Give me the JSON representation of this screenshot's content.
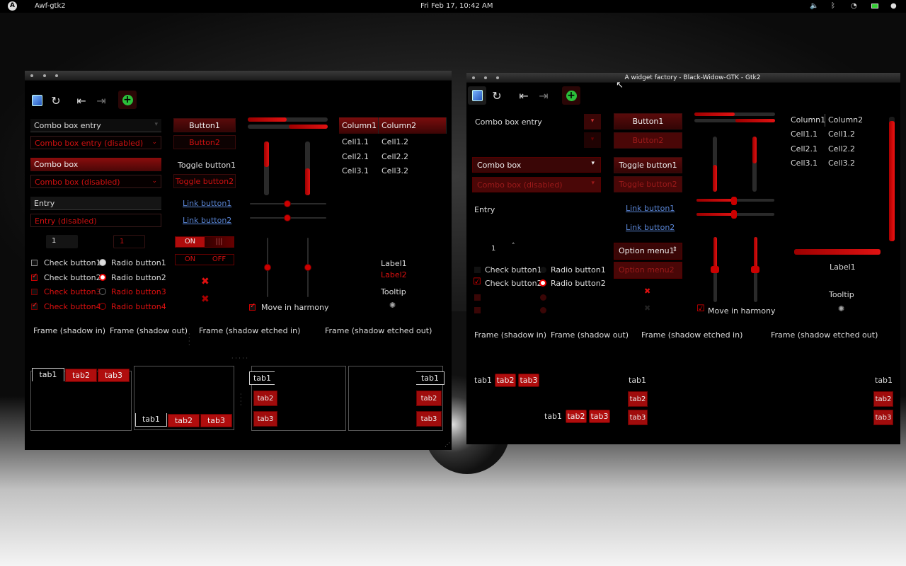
{
  "topbar": {
    "app": "Awf-gtk2",
    "clock": "Fri Feb 17, 10:42 AM"
  },
  "left": {
    "combo_entry": "Combo box entry",
    "combo_entry_dis": "Combo box entry (disabled)",
    "combo": "Combo box",
    "combo_dis": "Combo box (disabled)",
    "entry": "Entry",
    "entry_dis": "Entry (disabled)",
    "spin1": "1",
    "spin2": "1",
    "checks": [
      "Check button1",
      "Check button2",
      "Check button3",
      "Check button4"
    ],
    "radios": [
      "Radio button1",
      "Radio button2",
      "Radio button3",
      "Radio button4"
    ],
    "button1": "Button1",
    "button2": "Button2",
    "toggle1": "Toggle button1",
    "toggle2": "Toggle button2",
    "link1": "Link button1",
    "link2": "Link button2",
    "on": "ON",
    "off": "OFF",
    "bars": "|||",
    "columns": [
      "Column1",
      "Column2"
    ],
    "cells": [
      [
        "Cell1.1",
        "Cell1.2"
      ],
      [
        "Cell2.1",
        "Cell2.2"
      ],
      [
        "Cell3.1",
        "Cell3.2"
      ]
    ],
    "label1": "Label1",
    "label2": "Label2",
    "tooltip": "Tooltip",
    "move": "Move in harmony",
    "frames": [
      "Frame (shadow in)",
      "Frame (shadow out)",
      "Frame (shadow etched in)",
      "Frame (shadow etched out)"
    ],
    "tabs": [
      "tab1",
      "tab2",
      "tab3"
    ]
  },
  "right": {
    "title": "A widget factory - Black-Widow-GTK - Gtk2",
    "combo_entry": "Combo box entry",
    "combo": "Combo box",
    "combo_dis": "Combo box (disabled)",
    "entry": "Entry",
    "spin": "1",
    "button1": "Button1",
    "button2": "Button2",
    "toggle1": "Toggle button1",
    "toggle2": "Toggle button2",
    "link1": "Link button1",
    "link2": "Link button2",
    "opt1": "Option menu1",
    "opt2": "Option menu2",
    "checks": [
      "Check button1",
      "Check button2"
    ],
    "radios": [
      "Radio button1",
      "Radio button2"
    ],
    "columns": [
      "Column1",
      "Column2"
    ],
    "cells": [
      [
        "Cell1.1",
        "Cell1.2"
      ],
      [
        "Cell2.1",
        "Cell2.2"
      ],
      [
        "Cell3.1",
        "Cell3.2"
      ]
    ],
    "label1": "Label1",
    "tooltip": "Tooltip",
    "move": "Move in harmony",
    "frames": [
      "Frame (shadow in)",
      "Frame (shadow out)",
      "Frame (shadow etched in)",
      "Frame (shadow etched out)"
    ],
    "tabs": [
      "tab1",
      "tab2",
      "tab3"
    ]
  }
}
